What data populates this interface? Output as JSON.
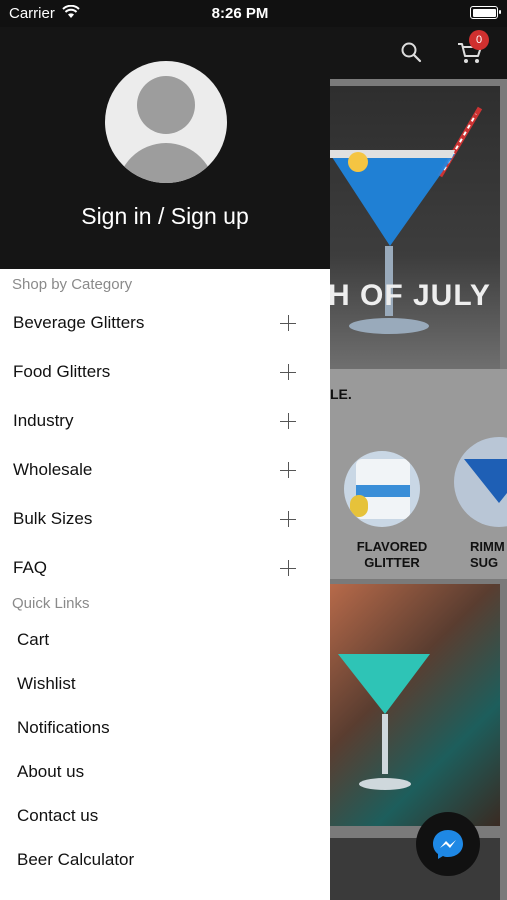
{
  "status_bar": {
    "carrier": "Carrier",
    "time": "8:26 PM"
  },
  "drawer": {
    "sign_in_label": "Sign in / Sign up",
    "category_heading": "Shop by Category",
    "categories": [
      {
        "label": "Beverage Glitters"
      },
      {
        "label": "Food Glitters"
      },
      {
        "label": "Industry"
      },
      {
        "label": "Wholesale"
      },
      {
        "label": "Bulk Sizes"
      },
      {
        "label": "FAQ"
      }
    ],
    "quick_links_heading": "Quick Links",
    "quick_links": [
      {
        "label": "Cart"
      },
      {
        "label": "Wishlist"
      },
      {
        "label": "Notifications"
      },
      {
        "label": "About us"
      },
      {
        "label": "Contact us"
      },
      {
        "label": "Beer Calculator"
      }
    ]
  },
  "background": {
    "cart_count": "0",
    "banner_text": "H OF JULY",
    "sale_text": "LE.",
    "products": [
      {
        "label": "FLAVORED\nGLITTER"
      },
      {
        "label": "RIMM\nSUG"
      }
    ]
  },
  "colors": {
    "header_bg": "#151515",
    "badge": "#d0302f",
    "drawer_bg": "#ffffff"
  }
}
